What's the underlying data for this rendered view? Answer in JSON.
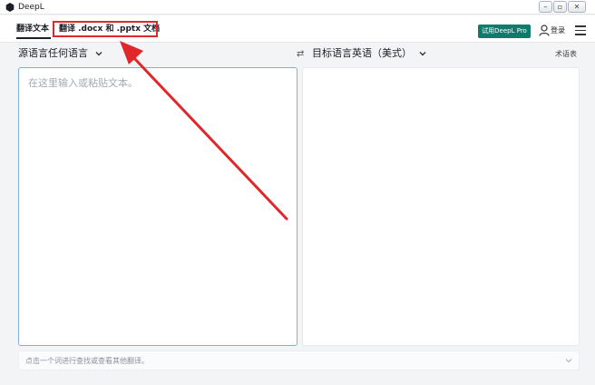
{
  "window": {
    "title": "DeepL"
  },
  "window_controls": {
    "minimize": "–",
    "maximize": "▫",
    "close": "✕"
  },
  "toolbar": {
    "tab_text": "翻译文本",
    "tab_docs": "翻译 .docx 和 .pptx 文档",
    "pro_button": "试用DeepL Pro",
    "login": "登录"
  },
  "languages": {
    "source": "源语言任何语言",
    "target": "目标语言英语（美式）",
    "swap_symbol": "⇄",
    "glossary": "术语表"
  },
  "source_panel": {
    "placeholder": "在这里输入或粘贴文本。"
  },
  "hint": {
    "text": "点击一个词进行查找或查看其他翻译。"
  },
  "colors": {
    "accent": "#0f7b6c",
    "annotation": "#e0272b",
    "focus_border": "#7fb3d3"
  },
  "icons": [
    "deepl-logo-icon",
    "user-icon",
    "hamburger-menu-icon",
    "chevron-down-icon",
    "swap-icon"
  ]
}
